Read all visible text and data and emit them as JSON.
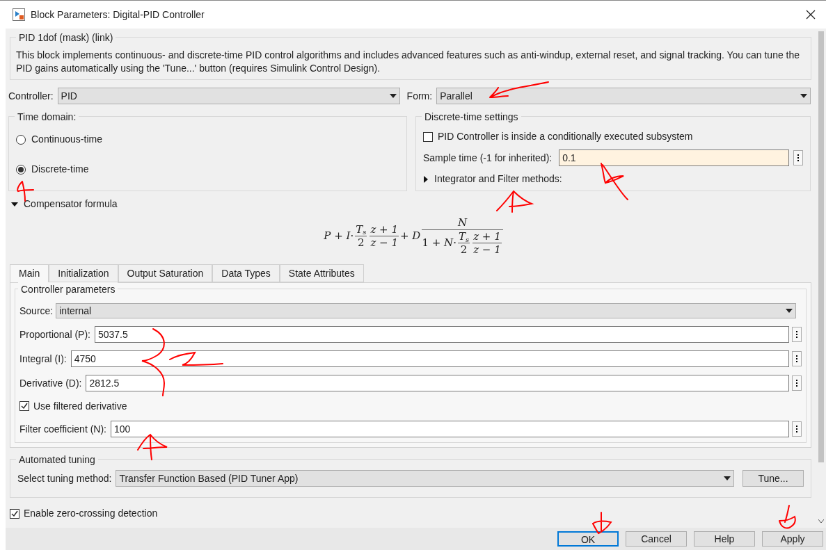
{
  "window": {
    "title": "Block Parameters: Digital-PID Controller"
  },
  "description": {
    "title": "PID 1dof (mask) (link)",
    "text": "This block implements continuous- and discrete-time PID control algorithms and includes advanced features such as anti-windup, external reset, and signal tracking. You can tune the PID gains automatically using the 'Tune...' button (requires Simulink Control Design)."
  },
  "controller": {
    "label": "Controller:",
    "value": "PID"
  },
  "form": {
    "label": "Form:",
    "value": "Parallel"
  },
  "time_domain": {
    "title": "Time domain:",
    "options": [
      {
        "label": "Continuous-time",
        "selected": false
      },
      {
        "label": "Discrete-time",
        "selected": true
      }
    ]
  },
  "discrete_settings": {
    "title": "Discrete-time settings",
    "conditional": {
      "label": "PID Controller is inside a conditionally executed subsystem",
      "checked": false
    },
    "sample_time": {
      "label": "Sample time (-1 for inherited):",
      "value": "0.1"
    },
    "methods": {
      "label": "Integrator and Filter methods:",
      "expanded": false
    }
  },
  "compensator": {
    "label": "Compensator formula",
    "expanded": true
  },
  "formula": {
    "p": "P",
    "plus1": "+",
    "i": "I",
    "dot1": "·",
    "t1": "T",
    "s1": "s",
    "two1": "2",
    "zp1": "z + 1",
    "zm1": "z − 1",
    "plus2": "+",
    "d": "D",
    "n1": "N",
    "one": "1",
    "plus3": "+",
    "n2": "N",
    "dot2": "·",
    "t2": "T",
    "s2": "s",
    "two2": "2",
    "zp2": "z + 1",
    "zm2": "z − 1"
  },
  "tabs": [
    {
      "label": "Main",
      "selected": true
    },
    {
      "label": "Initialization",
      "selected": false
    },
    {
      "label": "Output Saturation",
      "selected": false
    },
    {
      "label": "Data Types",
      "selected": false
    },
    {
      "label": "State Attributes",
      "selected": false
    }
  ],
  "controller_parameters": {
    "title": "Controller parameters",
    "source": {
      "label": "Source:",
      "value": "internal"
    },
    "fields": [
      {
        "kind": "field",
        "label": "Proportional (P):",
        "value": "5037.5"
      },
      {
        "kind": "field",
        "label": "Integral (I):",
        "value": "4750"
      },
      {
        "kind": "field",
        "label": "Derivative (D):",
        "value": "2812.5"
      },
      {
        "kind": "checkbox",
        "label": "Use filtered derivative",
        "checked": true
      },
      {
        "kind": "field",
        "label": "Filter coefficient (N):",
        "value": "100"
      }
    ]
  },
  "automated_tuning": {
    "title": "Automated tuning",
    "label": "Select tuning method:",
    "value": "Transfer Function Based (PID Tuner App)",
    "button": "Tune..."
  },
  "zero_crossing": {
    "label": "Enable zero-crossing detection",
    "checked": true
  },
  "buttons": [
    {
      "label": "OK",
      "default": true
    },
    {
      "label": "Cancel",
      "default": false
    },
    {
      "label": "Help",
      "default": false
    },
    {
      "label": "Apply",
      "default": false
    }
  ]
}
